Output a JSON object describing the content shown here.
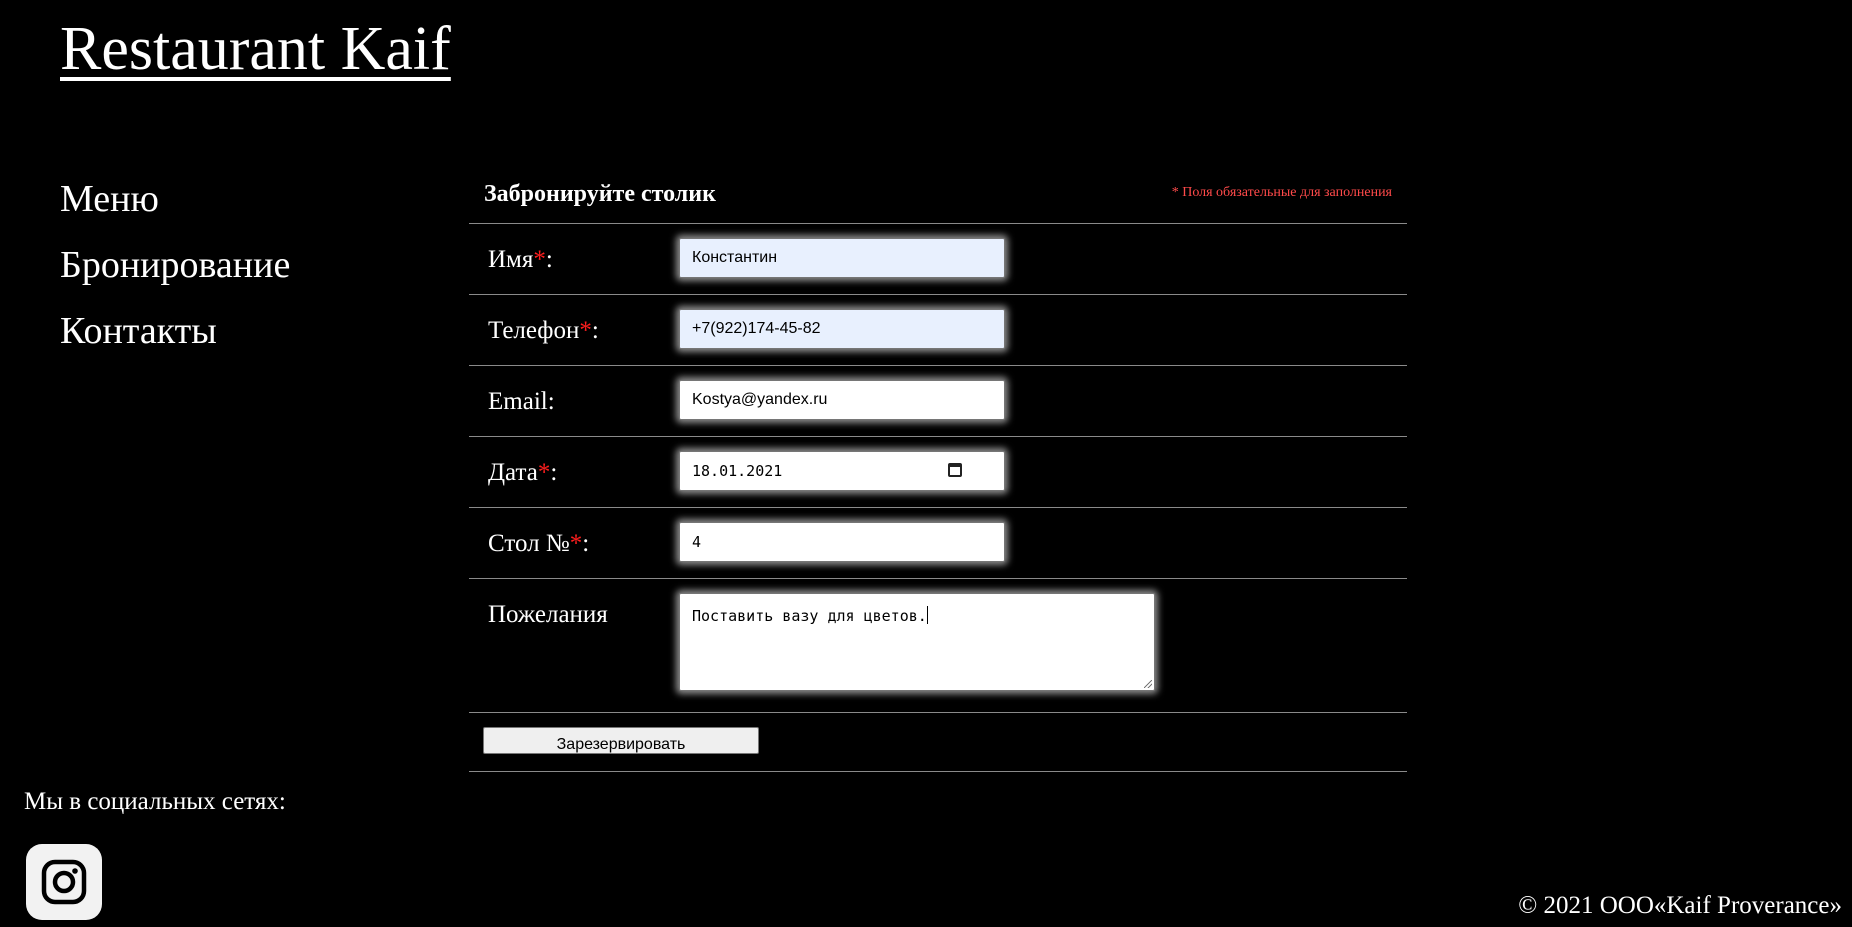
{
  "site": {
    "title": "Restaurant Kaif"
  },
  "nav": {
    "items": [
      {
        "label": "Меню"
      },
      {
        "label": "Бронирование"
      },
      {
        "label": "Контакты"
      }
    ]
  },
  "form": {
    "title": "Забронируйте столик",
    "required_note": "* Поля обязательные для заполнения",
    "required_marker": "*",
    "fields": {
      "name": {
        "label": "Имя",
        "suffix": ":",
        "value": "Константин"
      },
      "phone": {
        "label": "Телефон",
        "suffix": ":",
        "value": "+7(922)174-45-82"
      },
      "email": {
        "label": "Email:",
        "value": "Kostya@yandex.ru"
      },
      "date": {
        "label": "Дата",
        "suffix": ":",
        "value": "18.01.2021"
      },
      "table": {
        "label": "Стол №",
        "suffix": ":",
        "value": "4"
      },
      "wishes": {
        "label": "Пожелания",
        "value": "Поставить вазу для цветов."
      }
    },
    "submit_label": "Зарезервировать"
  },
  "social": {
    "label": "Мы в социальных сетях:",
    "icons": [
      "instagram-icon"
    ]
  },
  "footer": {
    "copyright": "© 2021 ООО«Kaif Proverance»"
  }
}
